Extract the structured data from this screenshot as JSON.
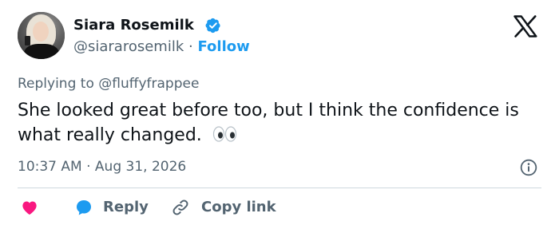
{
  "author": {
    "display_name": "Siara Rosemilk",
    "handle": "@siararosemilk",
    "separator": "·",
    "follow_label": "Follow",
    "verified_icon": "verified-badge-icon"
  },
  "reply_context": {
    "prefix": "Replying to",
    "target_handle": "@fluffyfrappee"
  },
  "tweet": {
    "text": "She looked great before too, but I think the confidence is what really changed.",
    "emoji": "eyes"
  },
  "meta": {
    "time": "10:37 AM",
    "separator": "·",
    "date": "Aug 31, 2026"
  },
  "actions": {
    "like_icon": "heart-icon",
    "reply_label": "Reply",
    "copy_link_label": "Copy link"
  },
  "colors": {
    "accent": "#1d9bf0",
    "like": "#f91880",
    "text_primary": "#0f1419",
    "text_secondary": "#536471",
    "divider": "#cfd9de"
  }
}
